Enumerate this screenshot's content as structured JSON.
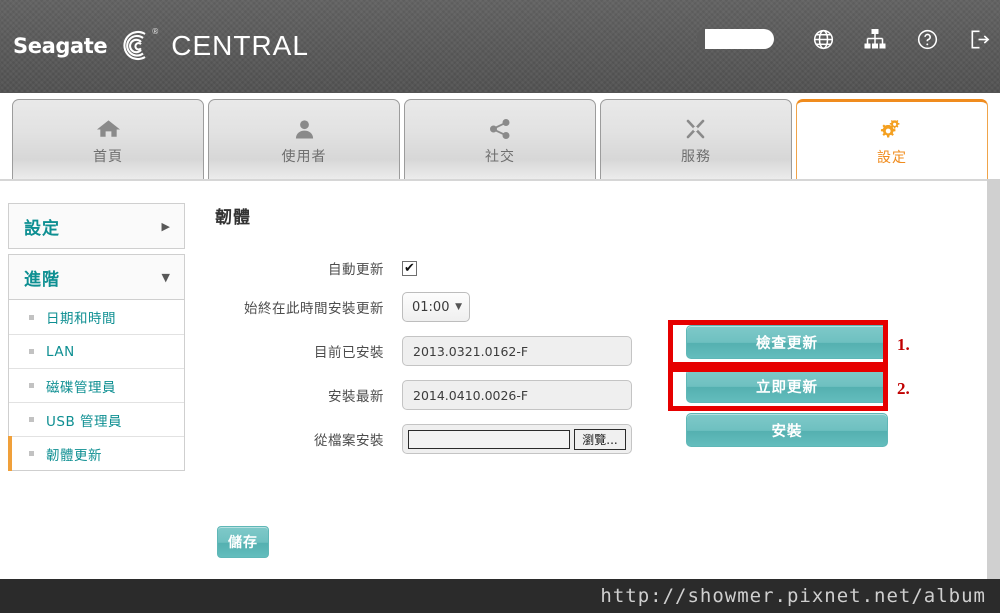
{
  "header": {
    "brand_name": "Seagate",
    "brand_registered": "®",
    "product_name": "CENTRAL",
    "icons": [
      {
        "name": "capacity-gauge",
        "glyph": ""
      },
      {
        "name": "globe-icon",
        "glyph": "⊕"
      },
      {
        "name": "network-icon",
        "glyph": ""
      },
      {
        "name": "help-icon",
        "glyph": "?"
      },
      {
        "name": "logout-icon",
        "glyph": ""
      }
    ]
  },
  "tabs": [
    {
      "id": "home",
      "label": "首頁",
      "icon": "home-icon",
      "active": false
    },
    {
      "id": "users",
      "label": "使用者",
      "icon": "user-icon",
      "active": false
    },
    {
      "id": "social",
      "label": "社交",
      "icon": "share-icon",
      "active": false
    },
    {
      "id": "services",
      "label": "服務",
      "icon": "tools-icon",
      "active": false
    },
    {
      "id": "settings",
      "label": "設定",
      "icon": "gears-icon",
      "active": true
    }
  ],
  "sidebar": {
    "groups": [
      {
        "label": "設定",
        "expanded": false,
        "arrow": "▶"
      },
      {
        "label": "進階",
        "expanded": true,
        "arrow": "▼"
      }
    ],
    "items": [
      {
        "label": "日期和時間",
        "active": false
      },
      {
        "label": "LAN",
        "active": false
      },
      {
        "label": "磁碟管理員",
        "active": false
      },
      {
        "label": "USB 管理員",
        "active": false
      },
      {
        "label": "韌體更新",
        "active": true
      }
    ]
  },
  "content": {
    "section_title": "韌體",
    "rows": [
      {
        "label": "自動更新",
        "control": "checkbox",
        "checked": true,
        "check_glyph": "✔"
      },
      {
        "label": "始終在此時間安裝更新",
        "control": "select",
        "value": "01:00",
        "caret": "▼"
      },
      {
        "label": "目前已安裝",
        "control": "textbox",
        "value": "2013.0321.0162-F",
        "button": "檢查更新"
      },
      {
        "label": "安裝最新",
        "control": "textbox",
        "value": "2014.0410.0026-F",
        "button": "立即更新"
      },
      {
        "label": "從檔案安裝",
        "control": "file",
        "value": "",
        "browse_label": "瀏覽...",
        "button": "安裝"
      }
    ],
    "save_label": "儲存"
  },
  "annotations": [
    {
      "number": "1.",
      "target": "檢查更新"
    },
    {
      "number": "2.",
      "target": "立即更新"
    }
  ],
  "footer": {
    "watermark": "http://showmer.pixnet.net/album"
  },
  "colors": {
    "accent_orange": "#f08c1e",
    "link_teal": "#0e8f92",
    "button_teal": "#6ec0c0",
    "annotation_red": "#e60000",
    "header_gray": "#5b5b5b"
  }
}
